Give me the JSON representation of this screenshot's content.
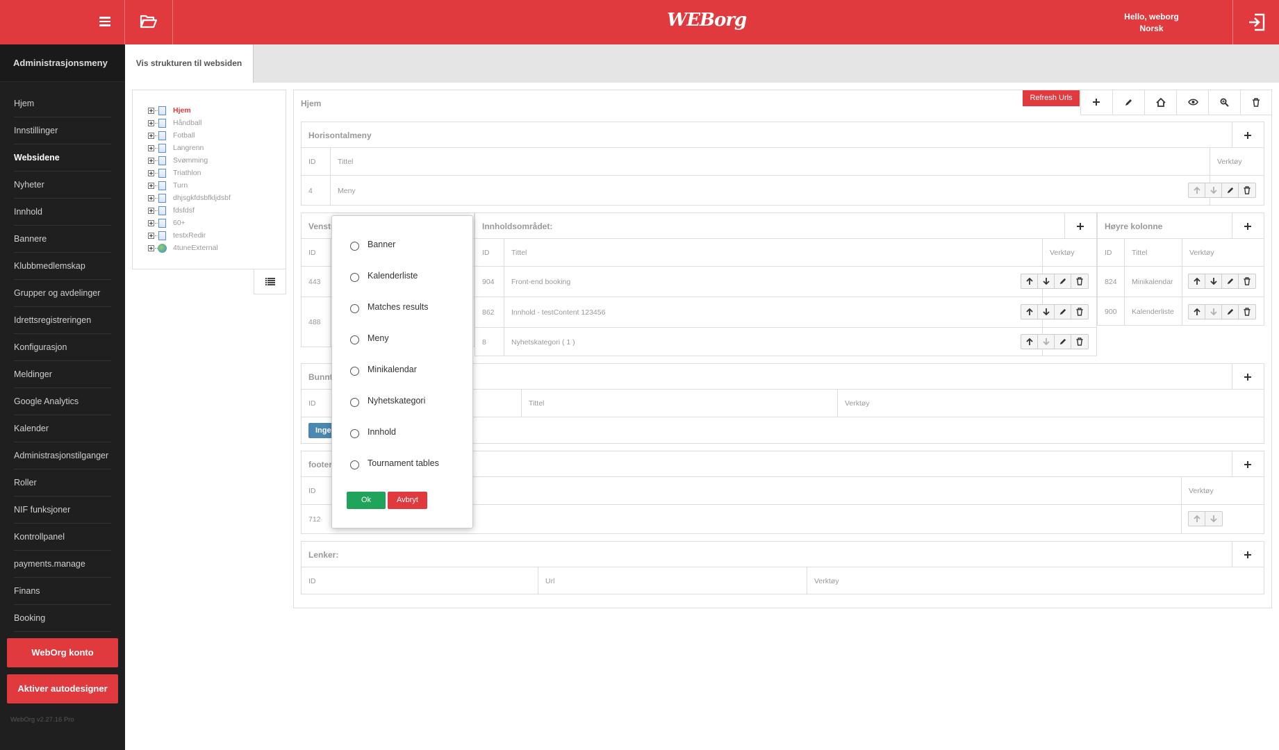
{
  "topbar": {
    "logo": "WEBorg",
    "greeting_prefix": "Hello, ",
    "username": "weborg",
    "language": "Norsk",
    "accent": "#e03a3e"
  },
  "sidebar": {
    "title": "Administrasjonsmeny",
    "items": [
      {
        "label": "Hjem"
      },
      {
        "label": "Innstillinger"
      },
      {
        "label": "Websidene",
        "active": true
      },
      {
        "label": "Nyheter"
      },
      {
        "label": "Innhold"
      },
      {
        "label": "Bannere"
      },
      {
        "label": "Klubbmedlemskap"
      },
      {
        "label": "Grupper og avdelinger"
      },
      {
        "label": "Idrettsregistreringen"
      },
      {
        "label": "Konfigurasjon"
      },
      {
        "label": "Meldinger"
      },
      {
        "label": "Google Analytics"
      },
      {
        "label": "Kalender"
      },
      {
        "label": "Administrasjonstilganger"
      },
      {
        "label": "Roller"
      },
      {
        "label": "NIF funksjoner"
      },
      {
        "label": "Kontrollpanel"
      },
      {
        "label": "payments.manage"
      },
      {
        "label": "Finans"
      },
      {
        "label": "Booking"
      }
    ],
    "weborg_konto": "WebOrg konto",
    "autodesigner": "Aktiver autodesigner",
    "version": "WebOrg v2.27.16 Pro"
  },
  "tabs": {
    "structure": "Vis strukturen til websiden"
  },
  "tree": [
    {
      "label": "Hjem",
      "current": true,
      "icon": "page-icon"
    },
    {
      "label": "Håndball",
      "icon": "page-icon"
    },
    {
      "label": "Fotball",
      "icon": "page-icon"
    },
    {
      "label": "Langrenn",
      "icon": "page-icon"
    },
    {
      "label": "Svømming",
      "icon": "page-icon"
    },
    {
      "label": "Triathlon",
      "icon": "page-icon"
    },
    {
      "label": "Turn",
      "icon": "page-icon"
    },
    {
      "label": "dhjsgkfdsbfkljdsbf",
      "icon": "page-icon"
    },
    {
      "label": "fdsfdsf",
      "icon": "page-icon"
    },
    {
      "label": "60+",
      "icon": "page-icon"
    },
    {
      "label": "testxRedir",
      "icon": "page-icon"
    },
    {
      "label": "4tuneExternal",
      "icon": "globe-icon"
    }
  ],
  "main": {
    "title": "Hjem",
    "refresh": "Refresh Urls",
    "toolbar_icons": [
      "plus-icon",
      "pencil-icon",
      "home-icon",
      "eye-icon",
      "zoom-icon",
      "trash-icon"
    ]
  },
  "horisontalmeny": {
    "title": "Horisontalmeny",
    "headers": {
      "id": "ID",
      "title": "Tittel",
      "tools": "Verktøy"
    },
    "rows": [
      {
        "id": "4",
        "title": "Meny"
      }
    ]
  },
  "venstre": {
    "title": "Venstre kolonne",
    "headers": {
      "id": "ID"
    },
    "rows": [
      {
        "id": "443"
      },
      {
        "id": "488"
      }
    ]
  },
  "innhold": {
    "title": "Innholdsområdet:",
    "headers": {
      "id": "ID",
      "title": "Tittel",
      "tools": "Verktøy"
    },
    "rows": [
      {
        "id": "904",
        "title": "Front-end booking"
      },
      {
        "id": "862",
        "title": "Innhold - testContent 123456"
      },
      {
        "id": "8",
        "title": "Nyhetskategori ( 1 )"
      }
    ]
  },
  "hoyre": {
    "title": "Høyre kolonne",
    "headers": {
      "id": "ID",
      "title": "Tittel",
      "tools": "Verktøy"
    },
    "rows": [
      {
        "id": "824",
        "title": "Minikalendar"
      },
      {
        "id": "900",
        "title": "Kalenderliste"
      }
    ]
  },
  "bunntekst": {
    "title": "Bunntekst",
    "headers": {
      "id": "ID",
      "title": "Tittel",
      "tools": "Verktøy"
    },
    "ingen": "Ingen"
  },
  "footer": {
    "title": "footer",
    "headers": {
      "id": "ID",
      "tools": "Verktøy"
    },
    "rows": [
      {
        "id": "712"
      }
    ]
  },
  "lenker": {
    "title": "Lenker:",
    "headers": {
      "id": "ID",
      "url": "Url",
      "tools": "Verktøy"
    }
  },
  "dialog": {
    "options": [
      "Banner",
      "Kalenderliste",
      "Matches results",
      "Meny",
      "Minikalendar",
      "Nyhetskategori",
      "Innhold",
      "Tournament tables"
    ],
    "ok": "Ok",
    "cancel": "Avbryt"
  }
}
